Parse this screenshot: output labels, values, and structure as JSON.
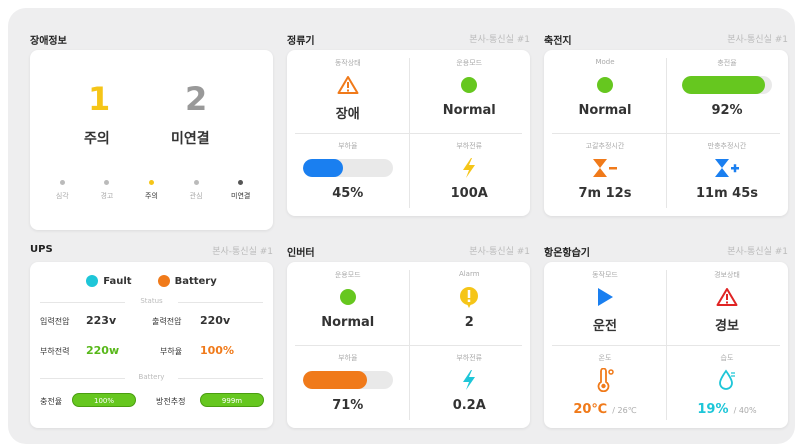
{
  "alarm_info": {
    "title": "장애정보",
    "warning_count": "1",
    "warning_label": "주의",
    "unlinked_count": "2",
    "unlinked_label": "미연결",
    "levels": [
      "심각",
      "경고",
      "주의",
      "관심",
      "미연결"
    ],
    "level_colors": [
      "#bbbbbb",
      "#bbbbbb",
      "#f5c518",
      "#bbbbbb",
      "#555555"
    ]
  },
  "rectifier": {
    "title": "정류기",
    "location": "본사-통신실 #1",
    "op_status_label": "동작상태",
    "op_status_value": "장애",
    "op_mode_label": "운용모드",
    "op_mode_value": "Normal",
    "load_rate_label": "부하율",
    "load_rate_value": "45%",
    "load_rate_fraction": 0.45,
    "load_current_label": "부하전류",
    "load_current_value": "100A"
  },
  "battery": {
    "title": "축전지",
    "location": "본사-통신실 #1",
    "mode_label": "Mode",
    "mode_value": "Normal",
    "charge_label": "충전율",
    "charge_value": "92%",
    "charge_fraction": 0.92,
    "discharge_label": "고갈추정시간",
    "discharge_value": "7m 12s",
    "fullcharge_label": "만충추정시간",
    "fullcharge_value": "11m 45s"
  },
  "ups": {
    "title": "UPS",
    "location": "본사-통신실 #1",
    "legend_fault": "Fault",
    "legend_battery": "Battery",
    "status_section": "Status",
    "input_voltage_label": "입력전압",
    "input_voltage_value": "223v",
    "output_voltage_label": "출력전압",
    "output_voltage_value": "220v",
    "load_power_label": "부하전력",
    "load_power_value": "220w",
    "load_rate_label": "부하율",
    "load_rate_value": "100%",
    "battery_section": "Battery",
    "charge_label": "충전율",
    "charge_value": "100%",
    "discharge_label": "방전추정",
    "discharge_value": "999m"
  },
  "inverter": {
    "title": "인버터",
    "location": "본사-통신실 #1",
    "op_mode_label": "운용모드",
    "op_mode_value": "Normal",
    "alarm_label": "Alarm",
    "alarm_value": "2",
    "load_rate_label": "부하율",
    "load_rate_value": "71%",
    "load_rate_fraction": 0.71,
    "load_current_label": "부하전류",
    "load_current_value": "0.2A"
  },
  "thermo": {
    "title": "항온항습기",
    "location": "본사-통신실 #1",
    "op_mode_label": "동작모드",
    "op_mode_value": "운전",
    "alarm_state_label": "경보상태",
    "alarm_state_value": "경보",
    "temp_label": "온도",
    "temp_value": "20℃",
    "temp_set": "/ 26℃",
    "humid_label": "습도",
    "humid_value": "19%",
    "humid_set": "/ 40%"
  }
}
